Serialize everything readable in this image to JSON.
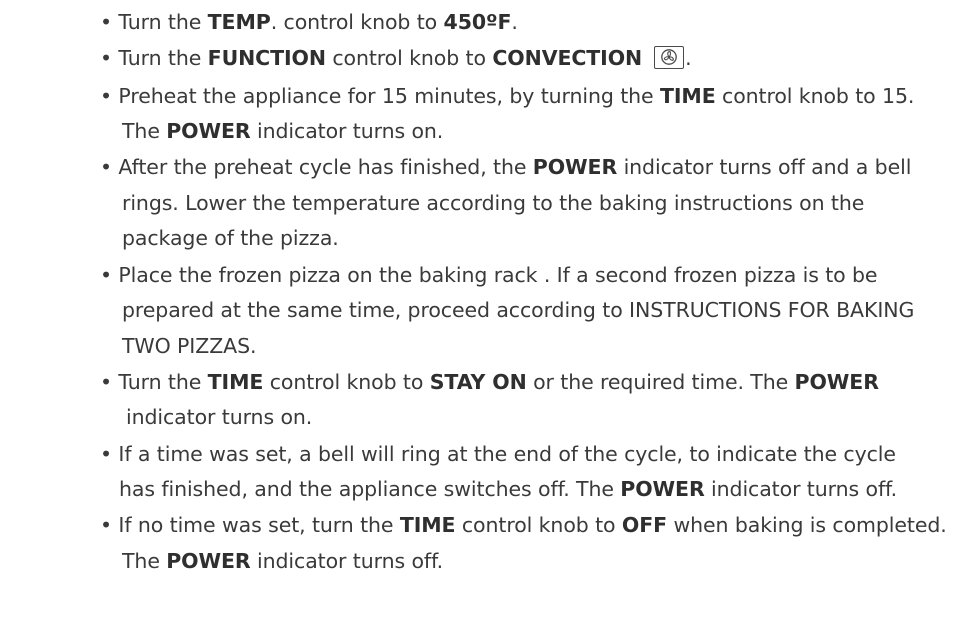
{
  "bullet": "•",
  "items": [
    {
      "lines": [
        [
          {
            "t": "Turn the "
          },
          {
            "t": "TEMP",
            "b": true
          },
          {
            "t": ". control knob to "
          },
          {
            "t": "450ºF",
            "b": true
          },
          {
            "t": "."
          }
        ]
      ]
    },
    {
      "lines": [
        [
          {
            "t": "Turn the "
          },
          {
            "t": "FUNCTION",
            "b": true
          },
          {
            "t": " control knob to "
          },
          {
            "t": "CONVECTION",
            "b": true
          },
          {
            "icon": "convection-fan-icon"
          },
          {
            "t": "."
          }
        ]
      ]
    },
    {
      "lines": [
        [
          {
            "t": "Preheat the appliance for 15 minutes, by turning the "
          },
          {
            "t": "TIME",
            "b": true
          },
          {
            "t": " control knob to 15."
          }
        ],
        [
          {
            "t": "The "
          },
          {
            "t": "POWER",
            "b": true
          },
          {
            "t": " indicator turns on."
          }
        ]
      ]
    },
    {
      "lines": [
        [
          {
            "t": "After the preheat cycle has finished, the "
          },
          {
            "t": "POWER",
            "b": true
          },
          {
            "t": " indicator turns off and a bell"
          }
        ],
        [
          {
            "t": "rings. Lower the temperature according to the baking instructions on the"
          }
        ],
        [
          {
            "t": "package of the pizza."
          }
        ]
      ]
    },
    {
      "lines": [
        [
          {
            "t": "Place the frozen pizza on the baking rack . If a second frozen pizza is to be"
          }
        ],
        [
          {
            "t": "prepared at the same time, proceed according to INSTRUCTIONS FOR BAKING"
          }
        ],
        [
          {
            "t": "TWO PIZZAS."
          }
        ]
      ]
    },
    {
      "lines": [
        [
          {
            "t": "Turn the "
          },
          {
            "t": "TIME",
            "b": true
          },
          {
            "t": " control knob to "
          },
          {
            "t": "STAY ON",
            "b": true
          },
          {
            "t": " or the required time.  The "
          },
          {
            "t": "POWER",
            "b": true
          }
        ],
        [
          {
            "t": " indicator turns on."
          }
        ]
      ]
    },
    {
      "lines": [
        [
          {
            "t": "If a time was set, a bell will ring at the end of the cycle, to indicate the cycle"
          }
        ],
        [
          {
            "t": "has  finished, and the appliance switches off. The "
          },
          {
            "t": "POWER",
            "b": true
          },
          {
            "t": " indicator turns off."
          }
        ]
      ]
    },
    {
      "lines": [
        [
          {
            "t": "If no time was set, turn the "
          },
          {
            "t": "TIME",
            "b": true
          },
          {
            "t": " control knob to "
          },
          {
            "t": "OFF",
            "b": true
          },
          {
            "t": " when baking is completed."
          }
        ],
        [
          {
            "t": "The "
          },
          {
            "t": "POWER",
            "b": true
          },
          {
            "t": " indicator turns off."
          }
        ]
      ]
    }
  ]
}
